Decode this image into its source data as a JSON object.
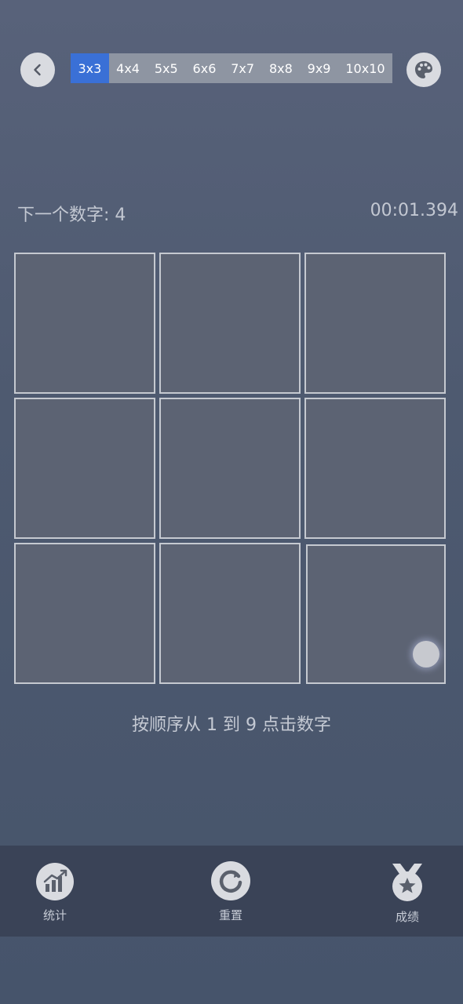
{
  "header": {
    "size_tabs": [
      {
        "label": "3x3",
        "active": true
      },
      {
        "label": "4x4",
        "active": false
      },
      {
        "label": "5x5",
        "active": false
      },
      {
        "label": "6x6",
        "active": false
      },
      {
        "label": "7x7",
        "active": false
      },
      {
        "label": "8x8",
        "active": false
      },
      {
        "label": "9x9",
        "active": false
      },
      {
        "label": "10x10",
        "active": false
      }
    ],
    "back_icon": "chevron-left-icon",
    "theme_icon": "palette-icon"
  },
  "game": {
    "next_number": "下一个数字: 4",
    "timer": "00:01.394",
    "grid_size": 3,
    "hint": "按顺序从 1 到 9 点击数字"
  },
  "bottom_nav": {
    "stats_label": "统计",
    "reset_label": "重置",
    "score_label": "成绩"
  },
  "colors": {
    "active_tab": "#3a70d6",
    "tab_bar": "#8e95a2",
    "cell_fill": "#5c6373",
    "cell_border": "#c5c9d0",
    "bottom_bar": "#3a4357"
  }
}
